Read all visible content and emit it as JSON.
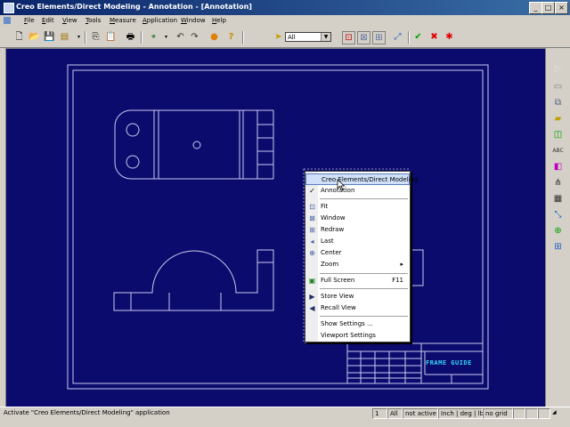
{
  "window": {
    "title": "Creo Elements/Direct Modeling - Annotation - [Annotation]",
    "controls": [
      "_",
      "□",
      "×"
    ]
  },
  "menubar": [
    "File",
    "Edit",
    "View",
    "Tools",
    "Measure",
    "Application",
    "Window",
    "Help"
  ],
  "toolbar": {
    "filter_value": "All",
    "filter_arrow": "▼",
    "icons": [
      "new-icon",
      "open-icon",
      "save-icon",
      "print-setup-icon",
      "copy-icon",
      "paste-icon",
      "print-icon",
      "transform-icon",
      "undo-icon",
      "redo-icon",
      "info-icon",
      "help-icon",
      "pointer-icon",
      "select-box-icon",
      "select-icon-2",
      "select-icon-3",
      "pick-icon",
      "ok-icon",
      "cancel-icon",
      "abort-icon"
    ]
  },
  "context_menu": {
    "items": [
      {
        "label": "Creo Elements/Direct Modeling",
        "highlighted": true
      },
      {
        "label": "Annotation",
        "checked": true,
        "check": "✓"
      },
      {
        "label": "Fit"
      },
      {
        "label": "Window"
      },
      {
        "label": "Redraw"
      },
      {
        "label": "Last"
      },
      {
        "label": "Center"
      },
      {
        "label": "Zoom",
        "submenu": "▸"
      },
      {
        "label": "Full Screen",
        "shortcut": "F11"
      },
      {
        "label": "Store View"
      },
      {
        "label": "Recall View"
      },
      {
        "label": "Show Settings ..."
      },
      {
        "label": "Viewport Settings"
      }
    ]
  },
  "drawing": {
    "title_block_text": "FRAME GUIDE"
  },
  "status": {
    "message": "Activate \"Creo Elements/Direct Modeling\" application",
    "page": "1",
    "filter": "All",
    "state": "not active",
    "units": "Inch | deg | lb",
    "grid": "no grid"
  },
  "colors": {
    "viewport_bg": "#0b0b6e",
    "drawing_lines": "#c8c8f0",
    "title_text": "#38d8f8",
    "menu_highlight": "#cfe0f8"
  }
}
